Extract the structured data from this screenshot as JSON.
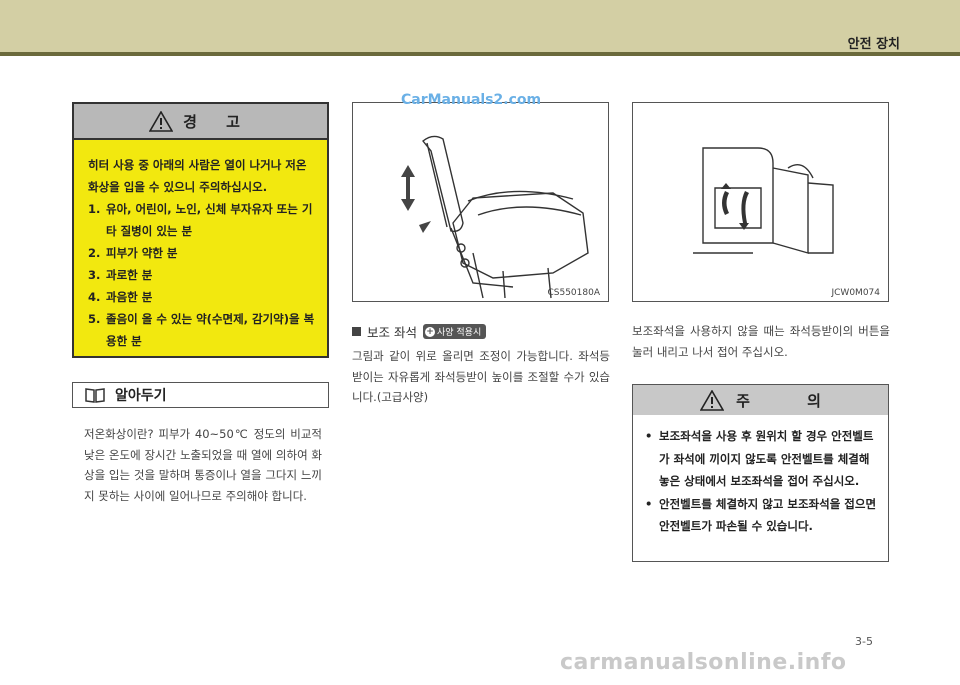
{
  "header": {
    "section_title": "안전 장치"
  },
  "warning": {
    "title": "경 고",
    "intro": "히터 사용 중 아래의 사람은 열이 나거나 저온화상을 입을 수 있으니 주의하십시오.",
    "items": [
      {
        "num": "1.",
        "text": "유아, 어린이, 노인, 신체 부자유자 또는 기타 질병이 있는 분"
      },
      {
        "num": "2.",
        "text": "피부가 약한 분"
      },
      {
        "num": "3.",
        "text": "과로한 분"
      },
      {
        "num": "4.",
        "text": "과음한 분"
      },
      {
        "num": "5.",
        "text": "졸음이 올 수 있는 약(수면제, 감기약)을 복용한 분"
      }
    ]
  },
  "note": {
    "title": "알아두기",
    "body": "저온화상이란? 피부가 40~50℃ 정도의 비교적 낮은 온도에 장시간 노출되었을 때 열에 의하여 화상을 입는 것을 말하며 통증이나 열을 그다지 느끼지 못하는 사이에 일어나므로 주의해야 합니다."
  },
  "figures": {
    "fig1_code": "CS550180A",
    "fig2_code": "JCW0M074",
    "watermark": "CarManuals2.com"
  },
  "middle": {
    "subtitle": "보조 좌석",
    "badge": "사양 적용시",
    "body": "그림과 같이 위로 올리면 조정이 가능합니다. 좌석등받이는 자유롭게 좌석등받이 높이를 조절할 수가 있습니다.(고급사양)"
  },
  "right": {
    "body": "보조좌석을 사용하지 않을 때는 좌석등받이의 버튼을 눌러 내리고 나서 접어 주십시오.",
    "caution_title": "주 의",
    "caution_items": [
      "보조좌석을 사용 후 원위치 할 경우 안전벨트가 좌석에 끼이지 않도록 안전벨트를 체결해 놓은 상태에서 보조좌석을 접어 주십시오.",
      "안전벨트를 체결하지 않고 보조좌석을 접으면 안전벨트가 파손될 수 있습니다."
    ]
  },
  "page_number": "3-5",
  "footer_watermark": "carmanualsonline.info",
  "colors": {
    "header_band": "#d3cfa4",
    "warning_bg": "#f2e80f",
    "head_gray": "#b8b8b8"
  }
}
